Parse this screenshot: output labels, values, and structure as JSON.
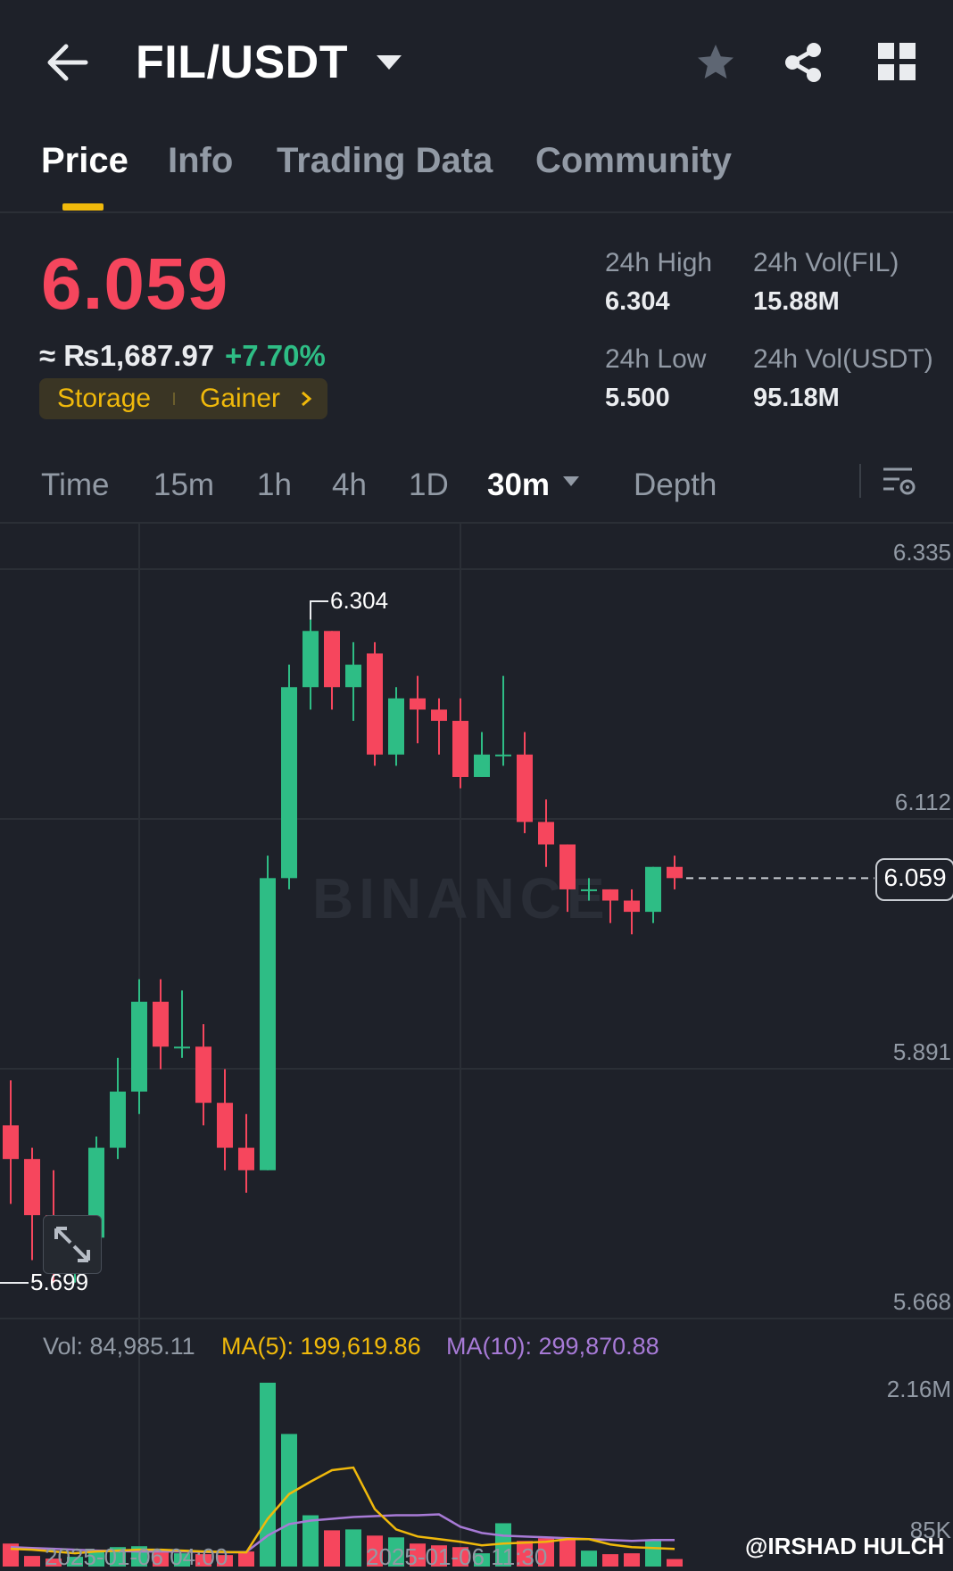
{
  "header": {
    "pair": "FIL/USDT"
  },
  "tabs": [
    {
      "label": "Price",
      "active": true
    },
    {
      "label": "Info"
    },
    {
      "label": "Trading Data"
    },
    {
      "label": "Community"
    }
  ],
  "price": {
    "last": "6.059",
    "fiat": "≈ ₨1,687.97",
    "change": "+7.70%",
    "tags": [
      "Storage",
      "Gainer"
    ],
    "high_label": "24h High",
    "high": "6.304",
    "low_label": "24h Low",
    "low": "5.500",
    "vol_fil_label": "24h Vol(FIL)",
    "vol_fil": "15.88M",
    "vol_usdt_label": "24h Vol(USDT)",
    "vol_usdt": "95.18M"
  },
  "intervals": {
    "items": [
      "Time",
      "15m",
      "1h",
      "4h",
      "1D"
    ],
    "selected": "30m",
    "depth": "Depth"
  },
  "chart": {
    "axis": [
      "6.335",
      "6.112",
      "5.891",
      "5.668"
    ],
    "high_marker": "6.304",
    "low_marker": "5.699",
    "current": "6.059",
    "watermark": "BINANCE",
    "vol_label": "Vol: 84,985.11",
    "ma5_label": "MA(5): 199,619.86",
    "ma10_label": "MA(10): 299,870.88",
    "vol_axis_top": "2.16M",
    "vol_axis_bottom": "85K",
    "dates": [
      "2025-01-06 04:00",
      "2025-01-06 11:30"
    ],
    "credit": "@IRSHAD HULCH"
  },
  "colors": {
    "up": "#2ebd85",
    "down": "#f6465d",
    "accent": "#f0b90b",
    "ma5": "#f0b90b",
    "ma10": "#a77ad6"
  },
  "chart_data": {
    "type": "candlestick",
    "y_range": [
      5.668,
      6.335
    ],
    "candles": [
      {
        "o": 5.84,
        "h": 5.88,
        "l": 5.77,
        "c": 5.81
      },
      {
        "o": 5.81,
        "h": 5.82,
        "l": 5.72,
        "c": 5.76
      },
      {
        "o": 5.76,
        "h": 5.8,
        "l": 5.7,
        "c": 5.72
      },
      {
        "o": 5.72,
        "h": 5.76,
        "l": 5.7,
        "c": 5.74
      },
      {
        "o": 5.74,
        "h": 5.83,
        "l": 5.73,
        "c": 5.82
      },
      {
        "o": 5.82,
        "h": 5.9,
        "l": 5.81,
        "c": 5.87
      },
      {
        "o": 5.87,
        "h": 5.97,
        "l": 5.85,
        "c": 5.95
      },
      {
        "o": 5.95,
        "h": 5.97,
        "l": 5.89,
        "c": 5.91
      },
      {
        "o": 5.91,
        "h": 5.96,
        "l": 5.9,
        "c": 5.91
      },
      {
        "o": 5.91,
        "h": 5.93,
        "l": 5.84,
        "c": 5.86
      },
      {
        "o": 5.86,
        "h": 5.89,
        "l": 5.8,
        "c": 5.82
      },
      {
        "o": 5.82,
        "h": 5.85,
        "l": 5.78,
        "c": 5.8
      },
      {
        "o": 5.8,
        "h": 6.08,
        "l": 5.8,
        "c": 6.06
      },
      {
        "o": 6.06,
        "h": 6.25,
        "l": 6.05,
        "c": 6.23
      },
      {
        "o": 6.23,
        "h": 6.29,
        "l": 6.21,
        "c": 6.28
      },
      {
        "o": 6.28,
        "h": 6.28,
        "l": 6.21,
        "c": 6.23
      },
      {
        "o": 6.23,
        "h": 6.27,
        "l": 6.2,
        "c": 6.25
      },
      {
        "o": 6.26,
        "h": 6.27,
        "l": 6.16,
        "c": 6.17
      },
      {
        "o": 6.17,
        "h": 6.23,
        "l": 6.16,
        "c": 6.22
      },
      {
        "o": 6.22,
        "h": 6.24,
        "l": 6.18,
        "c": 6.21
      },
      {
        "o": 6.21,
        "h": 6.22,
        "l": 6.17,
        "c": 6.2
      },
      {
        "o": 6.2,
        "h": 6.22,
        "l": 6.14,
        "c": 6.15
      },
      {
        "o": 6.15,
        "h": 6.19,
        "l": 6.15,
        "c": 6.17
      },
      {
        "o": 6.17,
        "h": 6.24,
        "l": 6.16,
        "c": 6.17
      },
      {
        "o": 6.17,
        "h": 6.19,
        "l": 6.1,
        "c": 6.11
      },
      {
        "o": 6.11,
        "h": 6.13,
        "l": 6.07,
        "c": 6.09
      },
      {
        "o": 6.09,
        "h": 6.09,
        "l": 6.03,
        "c": 6.05
      },
      {
        "o": 6.05,
        "h": 6.06,
        "l": 6.04,
        "c": 6.05
      },
      {
        "o": 6.05,
        "h": 6.05,
        "l": 6.02,
        "c": 6.04
      },
      {
        "o": 6.04,
        "h": 6.05,
        "l": 6.01,
        "c": 6.03
      },
      {
        "o": 6.03,
        "h": 6.07,
        "l": 6.02,
        "c": 6.07
      },
      {
        "o": 6.07,
        "h": 6.08,
        "l": 6.05,
        "c": 6.06
      }
    ],
    "volume_range": [
      0,
      2160000
    ],
    "volumes": [
      260000,
      120000,
      90000,
      110000,
      180000,
      220000,
      230000,
      160000,
      150000,
      140000,
      130000,
      170000,
      2080000,
      1500000,
      580000,
      410000,
      420000,
      350000,
      330000,
      260000,
      240000,
      220000,
      150000,
      490000,
      290000,
      320000,
      310000,
      180000,
      140000,
      150000,
      290000,
      85000
    ],
    "ma5": [
      200000,
      190000,
      170000,
      150000,
      170000,
      180000,
      190000,
      190000,
      180000,
      170000,
      165000,
      160000,
      540000,
      820000,
      960000,
      1090000,
      1120000,
      650000,
      420000,
      340000,
      310000,
      280000,
      240000,
      260000,
      270000,
      280000,
      310000,
      310000,
      250000,
      220000,
      210000,
      199620
    ],
    "ma10": [
      220000,
      210000,
      200000,
      190000,
      180000,
      175000,
      170000,
      170000,
      170000,
      165000,
      160000,
      165000,
      350000,
      480000,
      520000,
      540000,
      560000,
      570000,
      580000,
      580000,
      590000,
      450000,
      380000,
      350000,
      340000,
      330000,
      320000,
      310000,
      300000,
      290000,
      300000,
      299871
    ]
  }
}
